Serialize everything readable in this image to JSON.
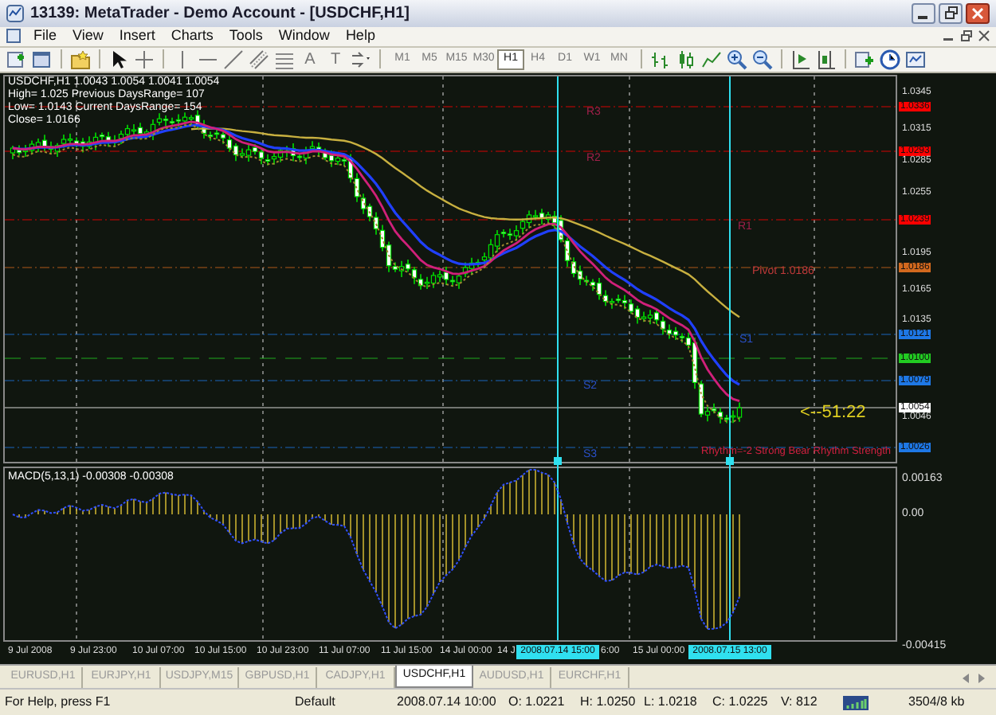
{
  "window": {
    "title": "13139: MetaTrader - Demo Account - [USDCHF,H1]"
  },
  "menu": [
    "File",
    "View",
    "Insert",
    "Charts",
    "Tools",
    "Window",
    "Help"
  ],
  "toolbar_glyphs": [
    "A",
    "T"
  ],
  "timeframes": [
    {
      "label": "M1",
      "selected": false
    },
    {
      "label": "M5",
      "selected": false
    },
    {
      "label": "M15",
      "selected": false
    },
    {
      "label": "M30",
      "selected": false
    },
    {
      "label": "H1",
      "selected": true
    },
    {
      "label": "H4",
      "selected": false
    },
    {
      "label": "D1",
      "selected": false
    },
    {
      "label": "W1",
      "selected": false
    },
    {
      "label": "MN",
      "selected": false
    }
  ],
  "chart": {
    "info": [
      "USDCHF,H1  1.0043 1.0054 1.0041 1.0054",
      "High= 1.025 Previous DaysRange= 107",
      "Low= 1.0143 Current DaysRange= 154",
      "Close= 1.0166"
    ],
    "level_labels": [
      {
        "text": "R3",
        "color": "#a0204a"
      },
      {
        "text": "R2",
        "color": "#a0204a"
      },
      {
        "text": "R1",
        "color": "#a0204a"
      },
      {
        "text": "Pivot  1.0186",
        "color": "#c03a3a"
      },
      {
        "text": "S1",
        "color": "#2a50c8"
      },
      {
        "text": "S2",
        "color": "#2a50c8"
      },
      {
        "text": "S3",
        "color": "#2a50c8"
      }
    ],
    "countdown": "<--51:22",
    "rhythm": "Rhythm=-2 Strong Bear Rhythm Strength",
    "price_axis": [
      {
        "text": "1.0345",
        "kind": "tick"
      },
      {
        "text": "1.0336",
        "kind": "badge",
        "color": "#ff0000"
      },
      {
        "text": "1.0315",
        "kind": "tick"
      },
      {
        "text": "1.0293",
        "kind": "badge",
        "color": "#ff0000"
      },
      {
        "text": "1.0285",
        "kind": "tick"
      },
      {
        "text": "1.0255",
        "kind": "tick"
      },
      {
        "text": "1.0239",
        "kind": "badge",
        "color": "#ff0000"
      },
      {
        "text": "1.0195",
        "kind": "tick"
      },
      {
        "text": "1.0186",
        "kind": "badge",
        "color": "#d2691e"
      },
      {
        "text": "1.0165",
        "kind": "tick"
      },
      {
        "text": "1.0135",
        "kind": "tick"
      },
      {
        "text": "1.0121",
        "kind": "badge",
        "color": "#1e78e6"
      },
      {
        "text": "1.0100",
        "kind": "badge",
        "color": "#22cc22"
      },
      {
        "text": "1.0079",
        "kind": "badge",
        "color": "#1e78e6"
      },
      {
        "text": "1.0054",
        "kind": "badge",
        "color": "#ffffff"
      },
      {
        "text": "1.0046",
        "kind": "tick"
      },
      {
        "text": "1.0026",
        "kind": "badge",
        "color": "#1e78e6"
      }
    ]
  },
  "macd": {
    "label": "MACD(5,13,1) -0.00308 -0.00308",
    "axis": [
      "0.00163",
      "0.00",
      "-0.00415"
    ]
  },
  "time_axis": [
    {
      "text": "9 Jul 2008",
      "kind": "tick"
    },
    {
      "text": "9 Jul 23:00",
      "kind": "tick"
    },
    {
      "text": "10 Jul 07:00",
      "kind": "tick"
    },
    {
      "text": "10 Jul 15:00",
      "kind": "tick"
    },
    {
      "text": "10 Jul 23:00",
      "kind": "tick"
    },
    {
      "text": "11 Jul 07:00",
      "kind": "tick"
    },
    {
      "text": "11 Jul 15:00",
      "kind": "tick"
    },
    {
      "text": "14 Jul 00:00",
      "kind": "tick"
    },
    {
      "text": "14 J",
      "kind": "tick"
    },
    {
      "text": "2008.07.14 15:00",
      "kind": "cursor"
    },
    {
      "text": "6:00",
      "kind": "tick"
    },
    {
      "text": "15 Jul 00:00",
      "kind": "tick"
    },
    {
      "text": "2008.07.15 13:00",
      "kind": "cursor"
    }
  ],
  "tabs": [
    {
      "label": "EURUSD,H1",
      "selected": false
    },
    {
      "label": "EURJPY,H1",
      "selected": false
    },
    {
      "label": "USDJPY,M15",
      "selected": false
    },
    {
      "label": "GBPUSD,H1",
      "selected": false
    },
    {
      "label": "CADJPY,H1",
      "selected": false
    },
    {
      "label": "USDCHF,H1",
      "selected": true
    },
    {
      "label": "AUDUSD,H1",
      "selected": false
    },
    {
      "label": "EURCHF,H1",
      "selected": false
    }
  ],
  "status_bar": [
    "For Help, press F1",
    "Default",
    "2008.07.14 10:00",
    "O: 1.0221",
    "H: 1.0250",
    "L: 1.0218",
    "C: 1.0225",
    "V: 812",
    "3504/8 kb"
  ]
}
